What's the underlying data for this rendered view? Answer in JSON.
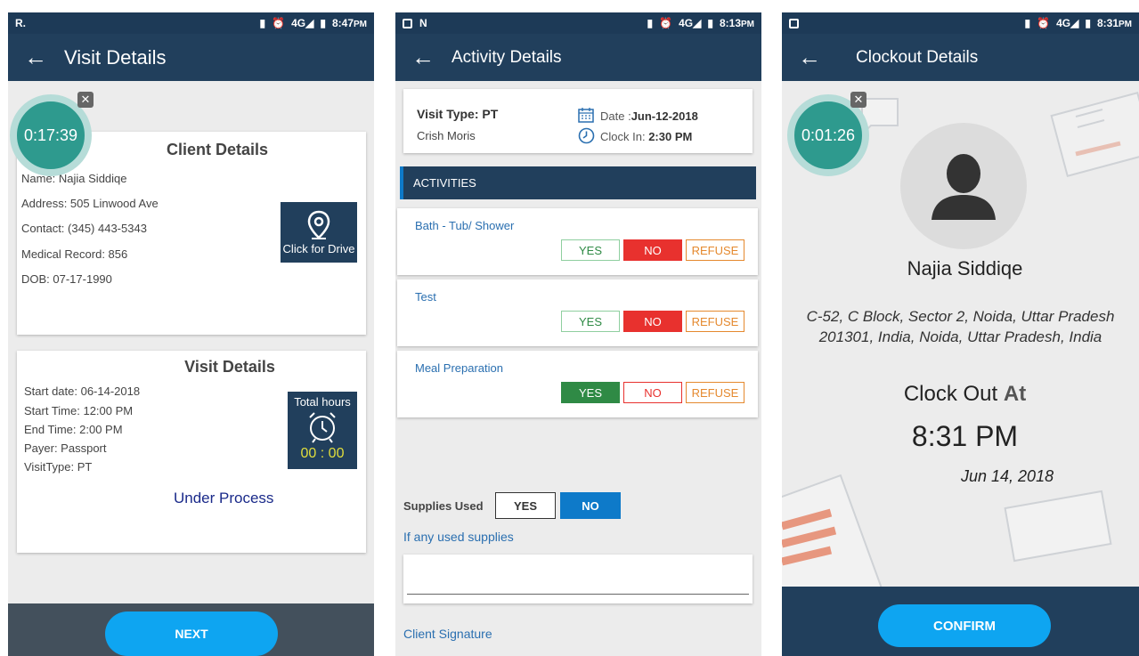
{
  "screen1": {
    "status_left": "R.",
    "status_time": "8:47",
    "status_ampm": "PM",
    "title": "Visit Details",
    "timer": "0:17:39",
    "client_heading": "Client Details",
    "name": "Name: Najia  Siddiqe",
    "address": "Address: 505 Linwood Ave",
    "contact": "Contact: (345) 443-5343",
    "medical": "Medical Record: 856",
    "dob": "DOB: 07-17-1990",
    "drive_label": "Click for Drive",
    "visit_heading": "Visit Details",
    "start_date": "Start date: 06-14-2018",
    "start_time": "Start Time: 12:00 PM",
    "end_time": "End Time: 2:00 PM",
    "payer": "Payer: Passport",
    "visit_type": "VisitType: PT",
    "total_hours_label": "Total hours",
    "total_hours_value": "00 : 00",
    "status": "Under Process",
    "next_label": "NEXT"
  },
  "screen2": {
    "status_time": "8:13",
    "status_ampm": "PM",
    "title": "Activity Details",
    "visit_type": "Visit Type: PT",
    "client": "Crish  Moris",
    "date_label": "Date :",
    "date_value": "Jun-12-2018",
    "clock_label": "Clock In:",
    "clock_value": "2:30 PM",
    "activities_header": "ACTIVITIES",
    "activities": [
      {
        "name": "Bath - Tub/ Shower",
        "selected": "NO"
      },
      {
        "name": "Test",
        "selected": "NO"
      },
      {
        "name": "Meal Preparation",
        "selected": "YES"
      }
    ],
    "opt_yes": "YES",
    "opt_no": "NO",
    "opt_refuse": "REFUSE",
    "supplies_label": "Supplies Used",
    "supplies_selected": "NO",
    "supplies_hint": "If any used supplies",
    "signature_label": "Client Signature"
  },
  "screen3": {
    "status_time": "8:31",
    "status_ampm": "PM",
    "title": "Clockout Details",
    "timer": "0:01:26",
    "name": "Najia  Siddiqe",
    "address_line1": "C-52, C Block, Sector 2, Noida, Uttar Pradesh",
    "address_line2": "201301, India, Noida, Uttar Pradesh, India",
    "clock_out_label": "Clock Out",
    "clock_out_at": "At",
    "clock_out_time": "8:31 PM",
    "clock_out_date": "Jun 14, 2018",
    "confirm_label": "CONFIRM"
  },
  "colors": {
    "header": "#213f5c",
    "teal": "#2e9a8e",
    "red": "#e8312e",
    "green": "#2f8a45",
    "blue": "#0e7ac9",
    "cta": "#0ea5f1",
    "orange": "#e5892e"
  },
  "icons": [
    "back-arrow-icon",
    "location-pin-icon",
    "alarm-clock-icon",
    "calendar-icon",
    "clock-icon",
    "user-avatar-icon",
    "close-icon"
  ]
}
